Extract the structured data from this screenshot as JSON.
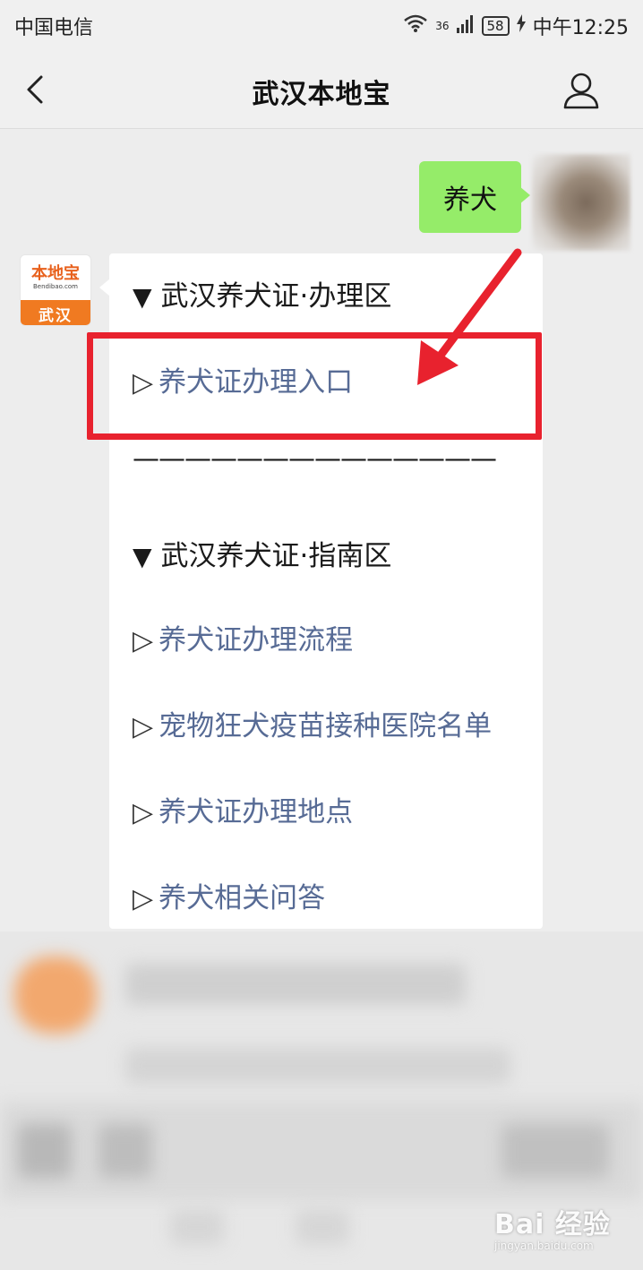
{
  "status_bar": {
    "carrier": "中国电信",
    "network": "36",
    "battery": "58",
    "time": "中午12:25"
  },
  "nav": {
    "title": "武汉本地宝"
  },
  "chat": {
    "user_message": "养犬",
    "bot_avatar": {
      "top_text": "本地宝",
      "sub_text": "Bendibao.com",
      "bottom_text": "武汉"
    },
    "bot_message": {
      "section1_title": "武汉养犬证·办理区",
      "section1_links": [
        "养犬证办理入口"
      ],
      "separator": "——————————————",
      "section2_title": "武汉养犬证·指南区",
      "section2_links": [
        "养犬证办理流程",
        "宠物狂犬疫苗接种医院名单",
        "养犬证办理地点",
        "养犬相关问答"
      ]
    }
  },
  "watermark": {
    "text": "Bai  经验",
    "sub": "jingyan.baidu.com"
  },
  "colors": {
    "link": "#576b95",
    "bubble_out": "#95ec69",
    "highlight": "#e8222e"
  }
}
